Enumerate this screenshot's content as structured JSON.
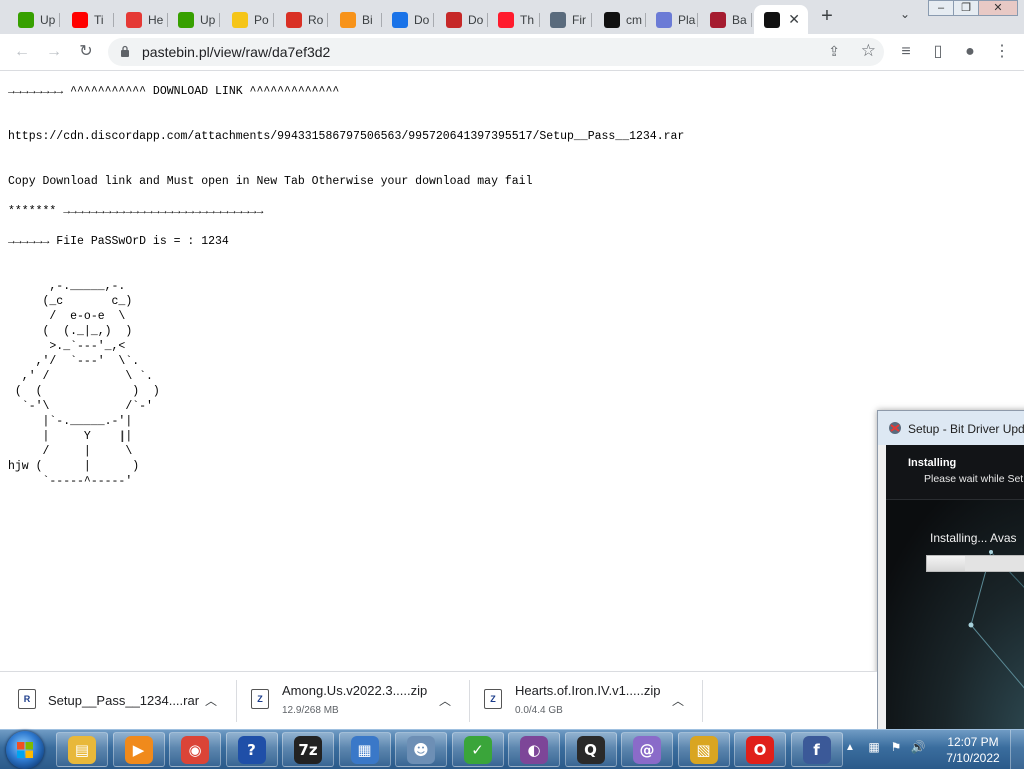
{
  "browser": {
    "tabs": [
      {
        "label": "Up",
        "icon": "upwork-icon",
        "color": "#37a000"
      },
      {
        "label": "Ti",
        "icon": "youtube-icon",
        "color": "#ff0000"
      },
      {
        "label": "He",
        "icon": "youtube-icon",
        "color": "#e53935"
      },
      {
        "label": "Up",
        "icon": "upwork-icon",
        "color": "#37a000"
      },
      {
        "label": "Po",
        "icon": "smiley-icon",
        "color": "#f5c518"
      },
      {
        "label": "Ro",
        "icon": "alert-icon",
        "color": "#d93025"
      },
      {
        "label": "Bi",
        "icon": "bitcoin-icon",
        "color": "#f7931a"
      },
      {
        "label": "Do",
        "icon": "download-icon",
        "color": "#1a73e8"
      },
      {
        "label": "Do",
        "icon": "circle-icon",
        "color": "#c62828"
      },
      {
        "label": "Th",
        "icon": "opera-icon",
        "color": "#ff1b2d"
      },
      {
        "label": "Fir",
        "icon": "gear-icon",
        "color": "#5a6b7d"
      },
      {
        "label": "cm",
        "icon": "terminal-icon",
        "color": "#111111"
      },
      {
        "label": "Pla",
        "icon": "rocket-icon",
        "color": "#6b7bd6"
      },
      {
        "label": "Ba",
        "icon": "ba-icon",
        "color": "#a51c30"
      },
      {
        "label": "",
        "icon": "terminal-icon",
        "color": "#111111",
        "active": true
      }
    ],
    "new_tab_symbol": "+",
    "tab_search_symbol": "⌄",
    "window_buttons": {
      "minimize": "–",
      "maximize": "❐",
      "close": "✕"
    },
    "toolbar": {
      "back": "←",
      "forward": "→",
      "reload": "↻",
      "url": "pastebin.pl/view/raw/da7ef3d2",
      "share": "⇪",
      "star": "☆",
      "media": "≡",
      "sidepanel": "▯",
      "profile": "●",
      "menu": "⋮"
    }
  },
  "page": {
    "paste_lines": [
      "→→→→→→→→ ^^^^^^^^^^^ DOWNLOAD LINK ^^^^^^^^^^^^^",
      "",
      "",
      "https://cdn.discordapp.com/attachments/994331586797506563/995720641397395517/Setup__Pass__1234.rar",
      "",
      "",
      "Copy Download link and Must open in New Tab Otherwise your download may fail",
      "",
      "******* →→→→→→→→→→→→→→→→→→→→→→→→→→→→→",
      "",
      "→→→→→→ FiIe PaSSwOrD is = : 1234",
      "",
      "",
      "      ,-._____,-.",
      "     (_c       c_)",
      "      /  e-o-e  \\",
      "     (  (._|_,)  )",
      "      >._`---'_,<",
      "    ,'/  `---'  \\`.",
      "  ,' /           \\ `.",
      " (  (             )  )",
      "  `-'\\           /`-'",
      "     |`-._____.-'|",
      "     |     Y     |",
      "     /     |     \\",
      "hjw (      |      )",
      "     `-----^-----'"
    ]
  },
  "setup_window": {
    "title": "Setup - Bit Driver Upda",
    "heading": "Installing",
    "subtitle": "Please wait while Set",
    "status": "Installing... Avas",
    "progress": 0.3
  },
  "downloads": [
    {
      "name": "Setup__Pass__1234....rar",
      "status": "",
      "icon": "winrar-icon"
    },
    {
      "name": "Among.Us.v2022.3.....zip",
      "status": "12.9/268 MB",
      "icon": "zip-icon"
    },
    {
      "name": "Hearts.of.Iron.IV.v1.....zip",
      "status": "0.0/4.4 GB",
      "icon": "zip-icon"
    }
  ],
  "taskbar": {
    "apps": [
      {
        "name": "explorer",
        "icon": "folder-icon",
        "color": "#e8b83a",
        "glyph": "▤"
      },
      {
        "name": "media-player",
        "icon": "media-player-icon",
        "color": "#f08a1c",
        "glyph": "▶"
      },
      {
        "name": "chrome",
        "icon": "chrome-icon",
        "color": "#db4437",
        "glyph": "◉"
      },
      {
        "name": "help",
        "icon": "help-icon",
        "color": "#1f4fa8",
        "glyph": "?"
      },
      {
        "name": "7zip",
        "icon": "sevenzip-icon",
        "color": "#222222",
        "glyph": "7z"
      },
      {
        "name": "control-panel",
        "icon": "control-panel-icon",
        "color": "#3a78c8",
        "glyph": "▦"
      },
      {
        "name": "users",
        "icon": "users-icon",
        "color": "#6d8fb5",
        "glyph": "☻"
      },
      {
        "name": "setup",
        "icon": "setup-icon",
        "color": "#3aa53a",
        "glyph": "✓"
      },
      {
        "name": "tor-browser",
        "icon": "tor-icon",
        "color": "#7d4698",
        "glyph": "◐"
      },
      {
        "name": "q-app",
        "icon": "q-icon",
        "color": "#2a2a2a",
        "glyph": "Q"
      },
      {
        "name": "q-app-2",
        "icon": "q-purple-icon",
        "color": "#8a6bc9",
        "glyph": "@"
      },
      {
        "name": "notes",
        "icon": "notes-icon",
        "color": "#d9a521",
        "glyph": "▧"
      },
      {
        "name": "opera",
        "icon": "opera-icon",
        "color": "#e0201b",
        "glyph": "O"
      },
      {
        "name": "facebook",
        "icon": "facebook-icon",
        "color": "#3b5998",
        "glyph": "f"
      }
    ],
    "tray_arrow": "▲",
    "time": "12:07 PM",
    "date": "7/10/2022"
  }
}
